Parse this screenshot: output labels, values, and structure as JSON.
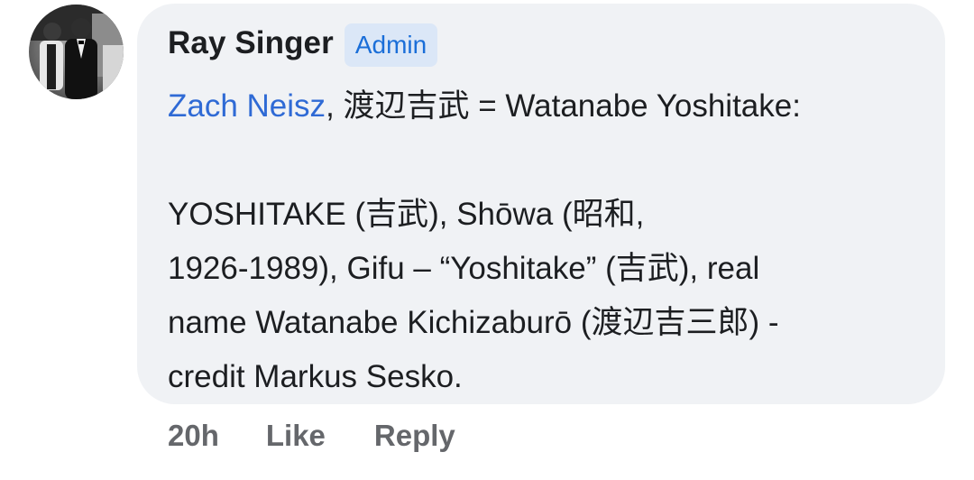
{
  "comment": {
    "author": "Ray Singer",
    "badge": "Admin",
    "mention": "Zach Neisz",
    "line1_rest": ", 渡辺吉武 = Watanabe Yoshitake:",
    "line2": "YOSHITAKE (吉武), Shōwa (昭和,",
    "line3": "1926-1989), Gifu – “Yoshitake” (吉武), real",
    "line4": "name Watanabe Kichizaburō (渡辺吉三郎) -",
    "line5": "credit Markus Sesko."
  },
  "actions": {
    "time": "20h",
    "like": "Like",
    "reply": "Reply"
  },
  "colors": {
    "bubble": "#f0f2f5",
    "mention": "#2f6ad5",
    "badge_bg": "#dbe7f7",
    "badge_text": "#1a6ed8",
    "meta_text": "#65676b"
  },
  "icons": {
    "avatar": "profile-photo"
  }
}
